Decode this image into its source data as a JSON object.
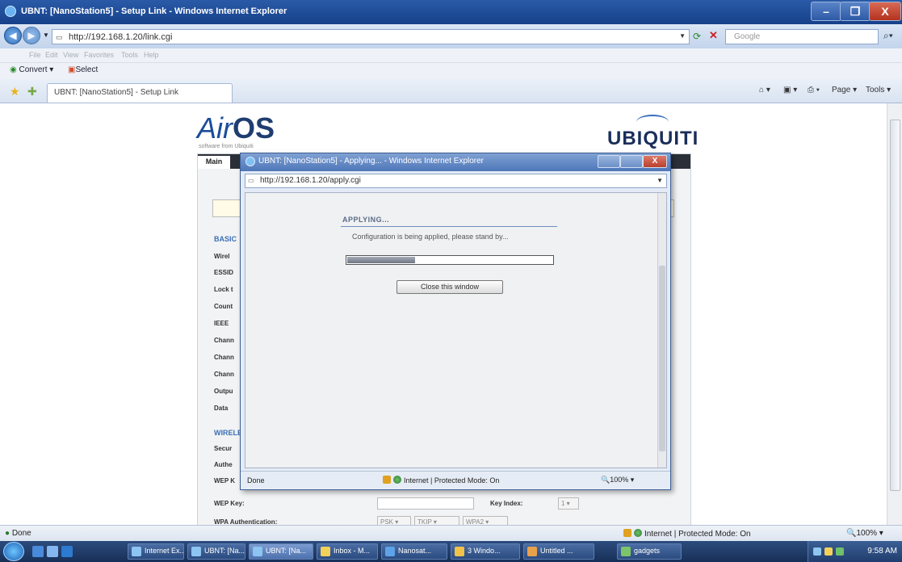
{
  "window": {
    "title": "UBNT: [NanoStation5] - Setup Link - Windows Internet Explorer",
    "controls": {
      "minimize": "–",
      "maximize": "❐",
      "close": "X"
    }
  },
  "address": {
    "url": "http://192.168.1.20/link.cgi",
    "search_placeholder": "Google"
  },
  "menu": [
    "File",
    "Edit",
    "View",
    "Favorites",
    "Tools",
    "Help"
  ],
  "links": {
    "convert": "Convert",
    "select": "Select"
  },
  "tabs": {
    "active_tab": "UBNT: [NanoStation5] - Setup Link",
    "tools": {
      "page": "Page",
      "tools": "Tools"
    }
  },
  "page": {
    "logo_text_a": "Air",
    "logo_text_b": "OS",
    "logo_sub": "software from Ubiquiti",
    "brand": "UBIQUITI",
    "main_tab": "Main",
    "sections": [
      "BASIC",
      "WIRELESS"
    ],
    "side_labels": [
      "Wirel",
      "ESSID",
      "Lock t",
      "Count",
      "IEEE",
      "Chann",
      "Chann",
      "Chann",
      "Outpu",
      "Data",
      "Secur",
      "Authe",
      "WEP K"
    ],
    "wep_key_label": "WEP Key:",
    "key_index_label": "Key Index:",
    "key_index_value": "1",
    "wpa_auth_label": "WPA Authentication:",
    "wpa_options": [
      "PSK",
      "TKIP",
      "WPA2"
    ]
  },
  "popup": {
    "title": "UBNT: [NanoStation5] - Applying... - Windows Internet Explorer",
    "url": "http://192.168.1.20/apply.cgi",
    "heading": "APPLYING...",
    "message": "Configuration is being applied, please stand by...",
    "progress_fraction": 0.33,
    "close_button": "Close this window",
    "status_done": "Done",
    "status_zone": "Internet | Protected Mode: On",
    "status_zoom": "100%"
  },
  "statusbar": {
    "done": "Done",
    "zone": "Internet | Protected Mode: On",
    "zoom": "100%"
  },
  "taskbar": {
    "buttons": [
      "Internet Ex...",
      "UBNT: [Na...",
      "UBNT: [Na...",
      "Inbox - M...",
      "Nanosat...",
      "3 Windo...",
      "Untitled ...",
      "gadgets"
    ],
    "clock": "9:58 AM"
  }
}
